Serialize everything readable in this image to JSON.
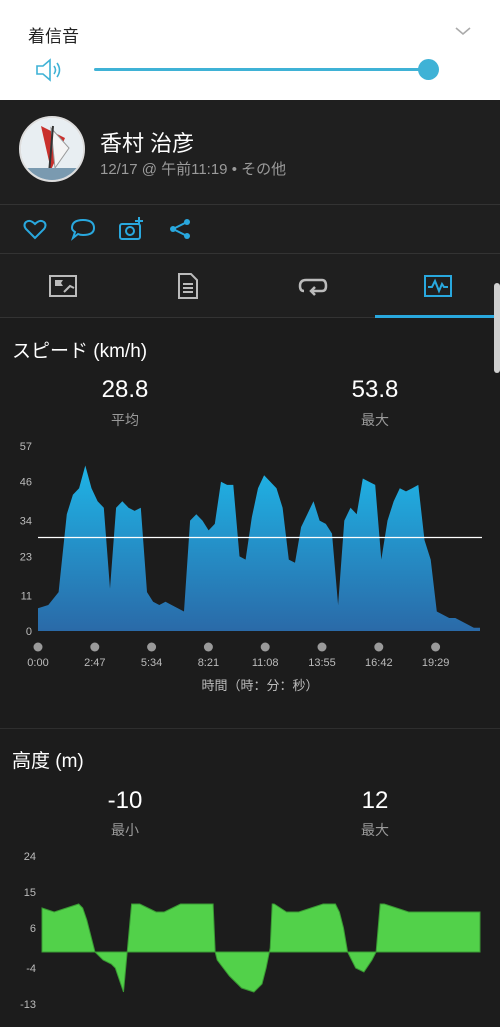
{
  "volume": {
    "title": "着信音",
    "level_percent": 100
  },
  "activity": {
    "user_name": "香村 治彦",
    "meta": "12/17 @ 午前11:19 • その他"
  },
  "icons": {
    "like": "heart-icon",
    "comment": "comment-icon",
    "photo": "camera-add-icon",
    "share": "share-icon"
  },
  "tabs": [
    {
      "name": "overview-tab",
      "icon": "map-flag-icon"
    },
    {
      "name": "details-tab",
      "icon": "document-icon"
    },
    {
      "name": "laps-tab",
      "icon": "loop-icon"
    },
    {
      "name": "charts-tab",
      "icon": "chart-icon",
      "active": true
    }
  ],
  "colors": {
    "accent": "#29a8de",
    "speed_fill": "#1f9bd1",
    "elev_fill": "#52d14a"
  },
  "speed": {
    "title": "スピード (km/h)",
    "avg_value": "28.8",
    "avg_label": "平均",
    "max_value": "53.8",
    "max_label": "最大",
    "x_axis_title": "時間（時：分：秒）"
  },
  "elevation": {
    "title": "高度 (m)",
    "min_value": "-10",
    "min_label": "最小",
    "max_value": "12",
    "max_label": "最大"
  },
  "chart_data": [
    {
      "type": "area",
      "title": "スピード (km/h)",
      "xlabel": "時間（時：分：秒）",
      "ylabel": "",
      "y_ticks": [
        "57",
        "46",
        "34",
        "23",
        "11",
        "0"
      ],
      "ylim": [
        0,
        57
      ],
      "x_ticks": [
        "0:00",
        "2:47",
        "5:34",
        "8:21",
        "11:08",
        "13:55",
        "16:42",
        "19:29"
      ],
      "average_line": 28.8,
      "x_minutes": [
        0,
        0.5,
        1,
        1.4,
        1.7,
        2.0,
        2.3,
        2.6,
        2.9,
        3.2,
        3.5,
        3.8,
        4.1,
        4.4,
        4.7,
        5.0,
        5.3,
        5.6,
        5.9,
        6.2,
        6.5,
        6.8,
        7.1,
        7.4,
        7.7,
        8.0,
        8.3,
        8.6,
        8.9,
        9.2,
        9.5,
        9.8,
        10.1,
        10.4,
        10.7,
        11.0,
        11.3,
        11.6,
        11.9,
        12.2,
        12.5,
        12.8,
        13.1,
        13.4,
        13.7,
        14.0,
        14.3,
        14.6,
        14.9,
        15.2,
        15.5,
        15.8,
        16.1,
        16.4,
        16.7,
        17.0,
        17.3,
        17.6,
        17.9,
        18.2,
        18.5,
        18.8,
        19.1,
        19.4,
        19.7,
        20.0,
        20.3,
        20.6,
        20.9,
        21.2,
        21.5
      ],
      "values": [
        7,
        8,
        12,
        36,
        42,
        44,
        51,
        44,
        40,
        38,
        13,
        38,
        40,
        38,
        37,
        38,
        12,
        9,
        8,
        9,
        8,
        7,
        6,
        34,
        36,
        34,
        31,
        33,
        46,
        45,
        45,
        23,
        22,
        35,
        44,
        48,
        46,
        44,
        38,
        22,
        21,
        32,
        36,
        40,
        34,
        33,
        30,
        8,
        34,
        38,
        36,
        47,
        46,
        45,
        22,
        34,
        40,
        44,
        43,
        44,
        45,
        28,
        22,
        6,
        5,
        4,
        4,
        3,
        2,
        1,
        1
      ]
    },
    {
      "type": "area",
      "title": "高度 (m)",
      "xlabel": "",
      "ylabel": "",
      "y_ticks": [
        "24",
        "15",
        "6",
        "-4",
        "-13"
      ],
      "ylim": [
        -13,
        24
      ],
      "x_minutes": [
        0,
        0.6,
        1.2,
        1.8,
        2.0,
        2.2,
        2.6,
        3.0,
        3.4,
        3.6,
        3.8,
        4.0,
        4.4,
        4.8,
        5.2,
        5.6,
        6.0,
        6.4,
        6.8,
        7.2,
        7.6,
        8.0,
        8.4,
        8.5,
        8.6,
        9.2,
        9.8,
        10.4,
        10.8,
        11.0,
        11.2,
        11.3,
        11.4,
        12.0,
        12.6,
        13.2,
        13.8,
        14.4,
        14.6,
        14.8,
        15.0,
        15.4,
        15.8,
        16.2,
        16.4,
        16.6,
        16.8,
        17.4,
        18.0,
        18.6,
        19.2,
        19.8,
        20.4,
        21.0,
        21.5
      ],
      "values": [
        11,
        10,
        11,
        12,
        11,
        8,
        0,
        -2,
        -3,
        -4,
        -7,
        -10,
        12,
        12,
        11,
        10,
        10,
        11,
        12,
        12,
        12,
        12,
        12,
        0,
        -2,
        -6,
        -9,
        -10,
        -8,
        -4,
        1,
        12,
        12,
        10,
        10,
        11,
        12,
        12,
        10,
        6,
        0,
        -4,
        -5,
        -2,
        0,
        12,
        12,
        11,
        10,
        10,
        10,
        10,
        10,
        10,
        10
      ]
    }
  ]
}
